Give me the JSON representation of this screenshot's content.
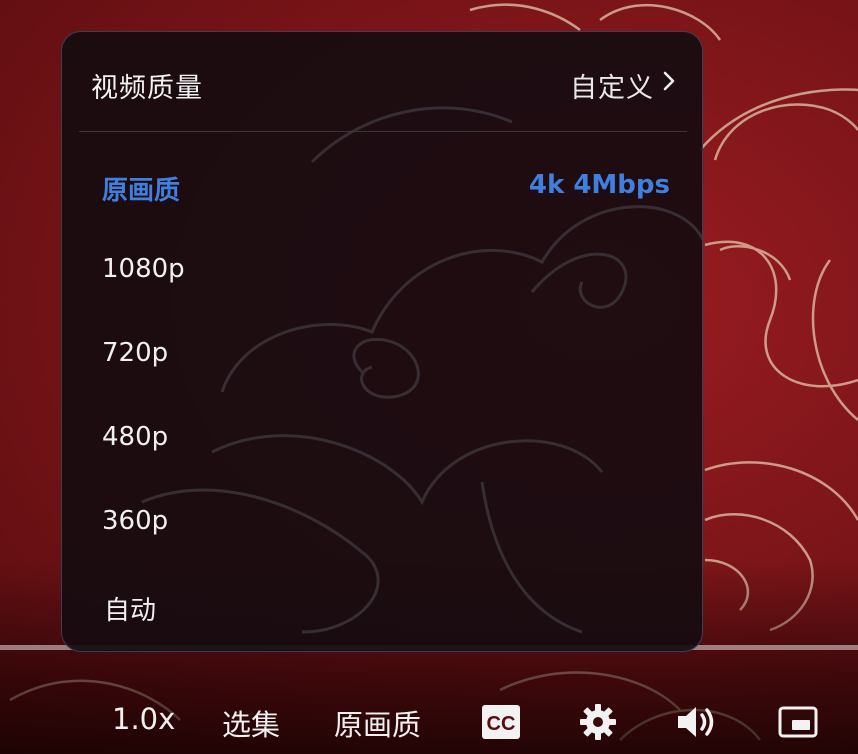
{
  "quality_menu": {
    "title": "视频质量",
    "custom_label": "自定义",
    "options": [
      {
        "label": "原画质",
        "detail": "4k 4Mbps",
        "selected": true
      },
      {
        "label": "1080p"
      },
      {
        "label": "720p"
      },
      {
        "label": "480p"
      },
      {
        "label": "360p"
      },
      {
        "label": "自动"
      }
    ]
  },
  "controls": {
    "speed": "1.0x",
    "episodes": "选集",
    "quality": "原画质",
    "cc_text": "CC",
    "icons": [
      "cc-icon",
      "gear-icon",
      "volume-icon",
      "miniplayer-icon"
    ]
  },
  "colors": {
    "accent": "#3f7fe0",
    "background_red": "#7d1519",
    "panel_bg": "#160c10"
  }
}
